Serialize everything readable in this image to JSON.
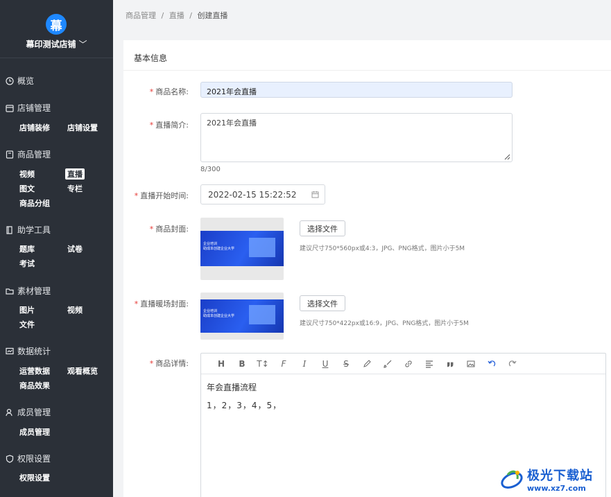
{
  "sidebar": {
    "logo_char": "幕",
    "store_name": "幕印测试店铺",
    "store_chevron": "﹀",
    "groups": [
      {
        "title": "概览",
        "icon": "clock-icon",
        "items": []
      },
      {
        "title": "店铺管理",
        "icon": "store-icon",
        "items": [
          "店铺装修",
          "店铺设置"
        ]
      },
      {
        "title": "商品管理",
        "icon": "product-icon",
        "items": [
          "视频",
          "直播",
          "图文",
          "专栏",
          "商品分组"
        ]
      },
      {
        "title": "助学工具",
        "icon": "book-icon",
        "items": [
          "题库",
          "试卷",
          "考试"
        ]
      },
      {
        "title": "素材管理",
        "icon": "folder-icon",
        "items": [
          "图片",
          "视频",
          "文件"
        ]
      },
      {
        "title": "数据统计",
        "icon": "chart-icon",
        "items": [
          "运营数据",
          "观看概览",
          "商品效果"
        ]
      },
      {
        "title": "成员管理",
        "icon": "user-icon",
        "items": [
          "成员管理"
        ]
      },
      {
        "title": "权限设置",
        "icon": "shield-icon",
        "items": [
          "权限设置"
        ]
      }
    ],
    "active_item": "直播"
  },
  "breadcrumb": [
    "商品管理",
    "/",
    "直播",
    "/",
    "创建直播"
  ],
  "form": {
    "section_title": "基本信息",
    "required_mark": "*",
    "name_label": "商品名称:",
    "name_value": "2021年会直播",
    "intro_label": "直播简介:",
    "intro_value": "2021年会直播",
    "intro_count": "8/300",
    "start_label": "直播开始时间:",
    "start_value": "2022-02-15 15:22:52",
    "cover_label": "商品封面:",
    "cover_button": "选择文件",
    "cover_hint": "建议尺寸750*560px或4:3，JPG、PNG格式，图片小于5M",
    "warmup_label": "直播暖场封面:",
    "warmup_button": "选择文件",
    "warmup_hint": "建议尺寸750*422px或16:9，JPG、PNG格式，图片小于5M",
    "detail_label": "商品详情:",
    "detail_line1": "年会直播流程",
    "detail_line2": "1，2，3，4，5，",
    "thumb_text1": "企业培训",
    "thumb_text2": "助成本创建企业大学"
  },
  "editor_toolbar": [
    "H",
    "B",
    "T↕",
    "F",
    "I",
    "U",
    "S",
    "pen-icon",
    "brush-icon",
    "link-icon",
    "align-icon",
    "quote-icon",
    "image-icon",
    "undo-icon",
    "redo-icon"
  ],
  "watermark": {
    "title": "极光下载站",
    "url": "www.xz7.com"
  },
  "colors": {
    "sidebar_bg": "#2b3038",
    "accent": "#1e88ff",
    "required": "#e53935",
    "input_fill": "#e8f0fe"
  }
}
